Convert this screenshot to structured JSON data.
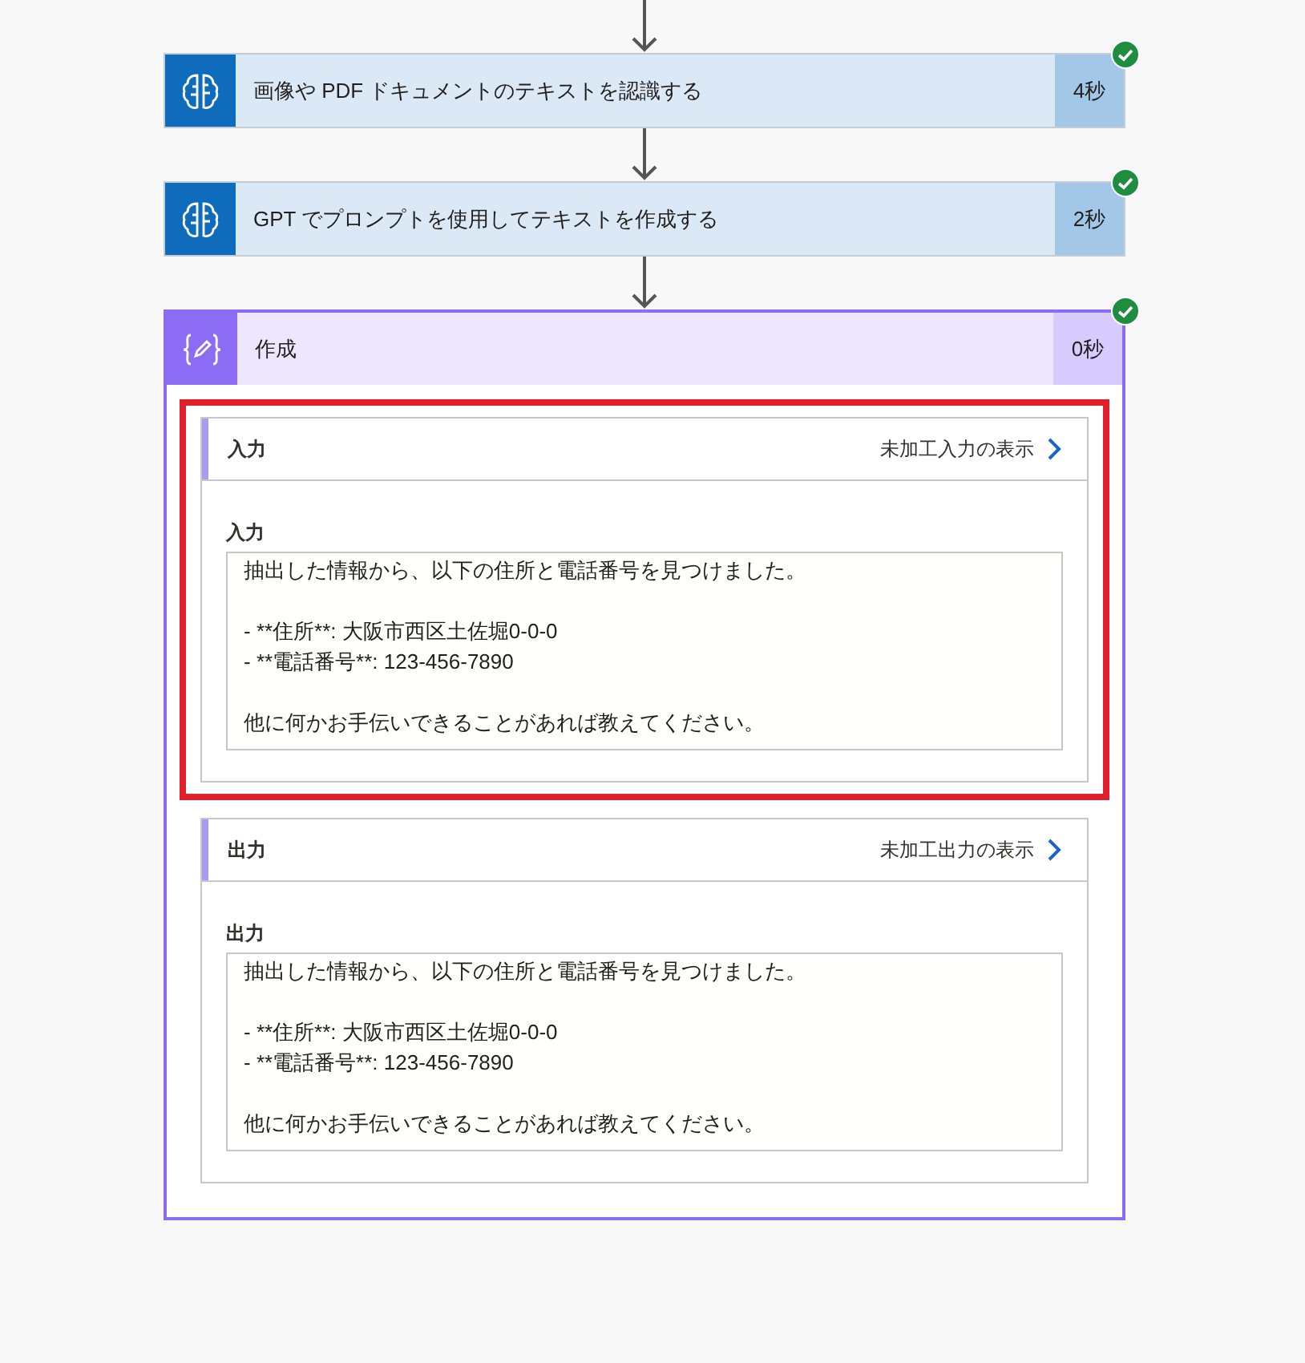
{
  "steps": [
    {
      "kind": "ai",
      "title": "画像や PDF ドキュメントのテキストを認識する",
      "duration": "4秒",
      "succeeded": true
    },
    {
      "kind": "ai",
      "title": "GPT でプロンプトを使用してテキストを作成する",
      "duration": "2秒",
      "succeeded": true
    },
    {
      "kind": "compose",
      "title": "作成",
      "duration": "0秒",
      "succeeded": true,
      "expanded": true,
      "sections": [
        {
          "header": "入力",
          "raw_link": "未加工入力の表示",
          "highlighted": true,
          "field_label": "入力",
          "paragraphs": [
            [
              "抽出した情報から、以下の住所と電話番号を見つけました。"
            ],
            [
              "- **住所**: 大阪市西区土佐堀0-0-0",
              "- **電話番号**: 123-456-7890"
            ],
            [
              "他に何かお手伝いできることがあれば教えてください。"
            ]
          ]
        },
        {
          "header": "出力",
          "raw_link": "未加工出力の表示",
          "highlighted": false,
          "field_label": "出力",
          "paragraphs": [
            [
              "抽出した情報から、以下の住所と電話番号を見つけました。"
            ],
            [
              "- **住所**: 大阪市西区土佐堀0-0-0",
              "- **電話番号**: 123-456-7890"
            ],
            [
              "他に何かお手伝いできることがあれば教えてください。"
            ]
          ]
        }
      ]
    }
  ]
}
